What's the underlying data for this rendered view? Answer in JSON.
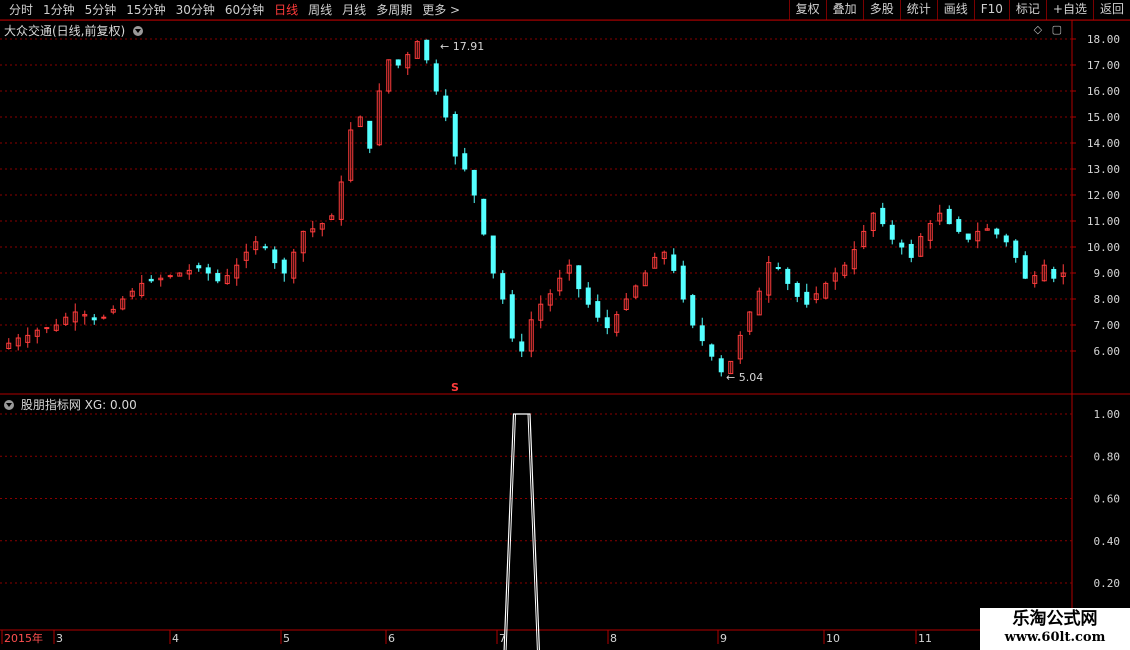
{
  "toolbar": {
    "periods": [
      "分时",
      "1分钟",
      "5分钟",
      "15分钟",
      "30分钟",
      "60分钟",
      "日线",
      "周线",
      "月线",
      "多周期",
      "更多 >"
    ],
    "active_index": 6,
    "right_buttons": [
      "复权",
      "叠加",
      "多股",
      "统计",
      "画线",
      "F10",
      "标记",
      "+自选",
      "返回"
    ]
  },
  "main_panel": {
    "title": "大众交通(日线,前复权)",
    "high_label": "17.91",
    "low_label": "5.04",
    "marker": "S",
    "price_ticks": [
      "18.00",
      "17.00",
      "16.00",
      "15.00",
      "14.00",
      "13.00",
      "12.00",
      "11.00",
      "10.00",
      "9.00",
      "8.00",
      "7.00",
      "6.00"
    ]
  },
  "indicator_panel": {
    "title": "股朋指标网 XG: 0.00",
    "ticks": [
      "1.00",
      "0.80",
      "0.60",
      "0.40",
      "0.20"
    ]
  },
  "time_axis": {
    "labels": [
      "2015年",
      "3",
      "4",
      "5",
      "6",
      "7",
      "8",
      "9",
      "10",
      "11"
    ]
  },
  "watermark": {
    "line1": "乐淘公式网",
    "line2": "www.60lt.com"
  },
  "colors": {
    "up": "#ff3c3c",
    "down": "#54ffff",
    "grid": "#8a0000",
    "border": "#b00000"
  },
  "chart_data": {
    "type": "candlestick",
    "price_range": [
      5,
      18.5
    ],
    "close_series": [
      6.3,
      6.5,
      6.6,
      6.8,
      6.9,
      7.0,
      7.3,
      7.5,
      7.4,
      7.2,
      7.3,
      7.6,
      8.0,
      8.3,
      8.6,
      8.7,
      8.8,
      8.9,
      9.0,
      9.1,
      9.2,
      9.0,
      8.7,
      8.9,
      9.3,
      9.8,
      10.2,
      10.0,
      9.4,
      9.0,
      9.8,
      10.6,
      10.7,
      10.9,
      11.2,
      12.5,
      14.5,
      15.0,
      13.8,
      16.0,
      17.2,
      17.0,
      17.4,
      17.9,
      17.2,
      16.0,
      15.0,
      13.5,
      13.0,
      12.0,
      10.5,
      9.0,
      8.0,
      6.5,
      6.0,
      7.2,
      7.8,
      8.2,
      8.8,
      9.3,
      8.4,
      7.8,
      7.3,
      6.9,
      7.4,
      8.0,
      8.5,
      9.0,
      9.6,
      9.8,
      9.1,
      8.0,
      7.0,
      6.4,
      5.8,
      5.2,
      5.6,
      6.6,
      7.5,
      8.3,
      9.4,
      9.2,
      8.6,
      8.1,
      7.8,
      8.2,
      8.6,
      9.0,
      9.3,
      9.9,
      10.6,
      11.3,
      10.9,
      10.3,
      10.0,
      9.6,
      10.4,
      10.9,
      11.3,
      10.9,
      10.6,
      10.3,
      10.6,
      10.7,
      10.5,
      10.2,
      9.6,
      8.8,
      8.9,
      9.3,
      8.8,
      9.0
    ],
    "xg_signal": {
      "x_start_index": 53,
      "x_end_index": 55,
      "value": 1.0
    },
    "ylabel": "",
    "xlabel": ""
  }
}
